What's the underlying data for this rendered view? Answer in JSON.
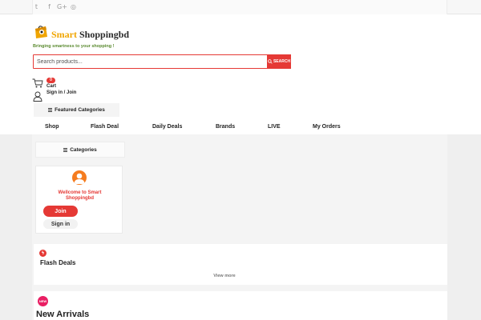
{
  "social": [
    {
      "name": "twitter-icon",
      "glyph": "t"
    },
    {
      "name": "facebook-icon",
      "glyph": "f"
    },
    {
      "name": "google-plus-icon",
      "glyph": "G+"
    },
    {
      "name": "instagram-icon",
      "glyph": "◎"
    }
  ],
  "brand": {
    "name_part1": "Smart ",
    "name_part2": "Shoppingbd",
    "tagline": "Bringing smartness to your shopping !"
  },
  "search": {
    "placeholder": "Search products...",
    "button_label": "SEARCH"
  },
  "cart": {
    "count": "0",
    "label": "Cart"
  },
  "account": {
    "label": "Sign in / Join"
  },
  "featured_categories": "Featured Categories",
  "nav": [
    {
      "label": "Shop"
    },
    {
      "label": "Flash Deal"
    },
    {
      "label": "Daily Deals"
    },
    {
      "label": "Brands"
    },
    {
      "label": "LIVE"
    },
    {
      "label": "My Orders"
    }
  ],
  "categories_label": "Categories",
  "welcome": {
    "text": "Wellcome to Smart Shoppingbd",
    "join_label": "Join",
    "signin_label": "Sign in"
  },
  "flash": {
    "title": "Flash Deals",
    "view_more": "View more"
  },
  "arrivals": {
    "badge": "NEW",
    "title": "New Arrivals"
  },
  "colors": {
    "accent": "#e53935",
    "brand_yellow": "#f0a500",
    "avatar": "#f57c1f"
  }
}
